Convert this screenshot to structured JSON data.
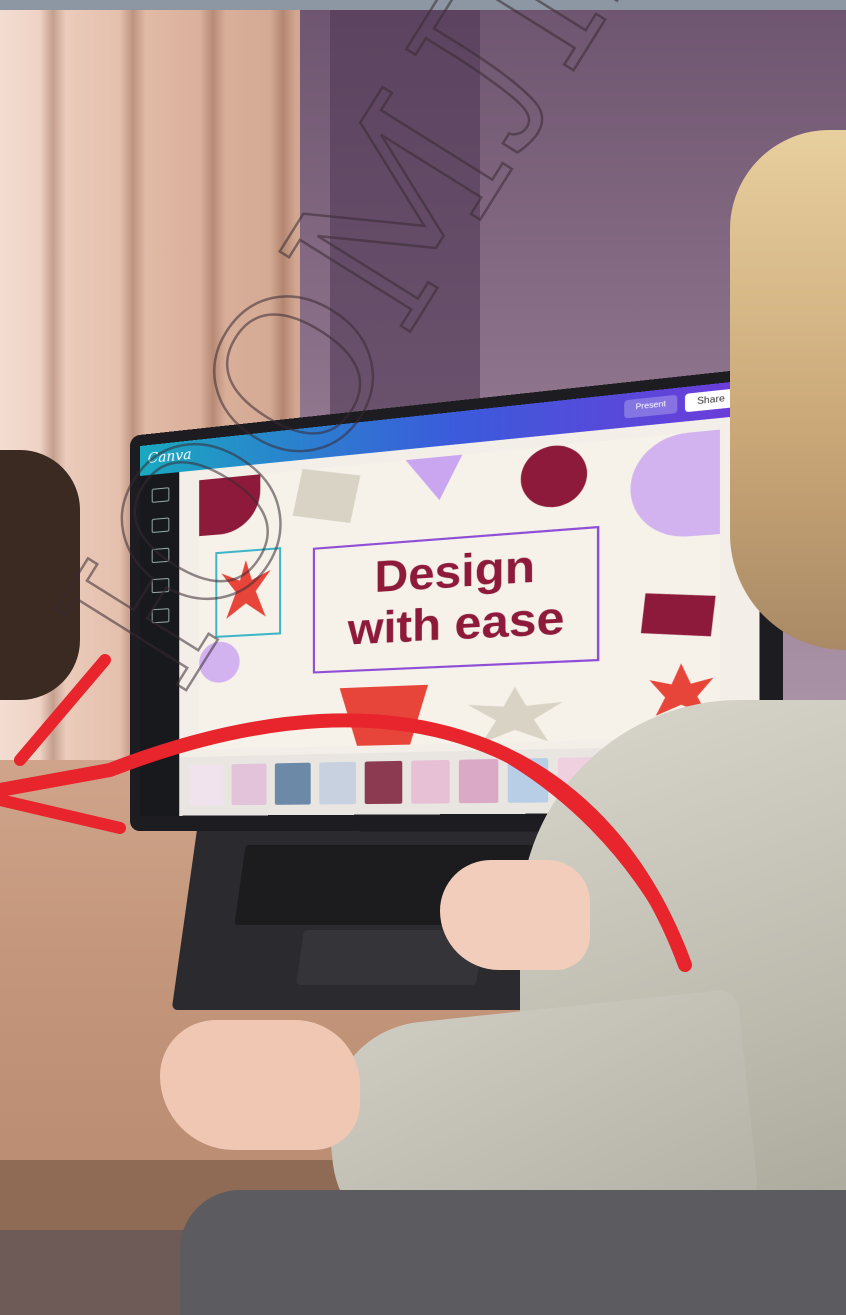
{
  "photo": {
    "description_icon": "person-using-laptop",
    "colors": {
      "accent_red": "#e8242c",
      "brand_wine": "#8d1a3a",
      "wall_purple": "#8a7088"
    }
  },
  "laptop_screen": {
    "app_logo": "Canva",
    "headline_line1": "Design",
    "headline_line2": "with ease",
    "share_label": "Share",
    "present_label": "Present"
  },
  "watermark": {
    "text": "ЮОМЛЕ"
  },
  "annotation": {
    "icon": "red-arrow-icon"
  }
}
